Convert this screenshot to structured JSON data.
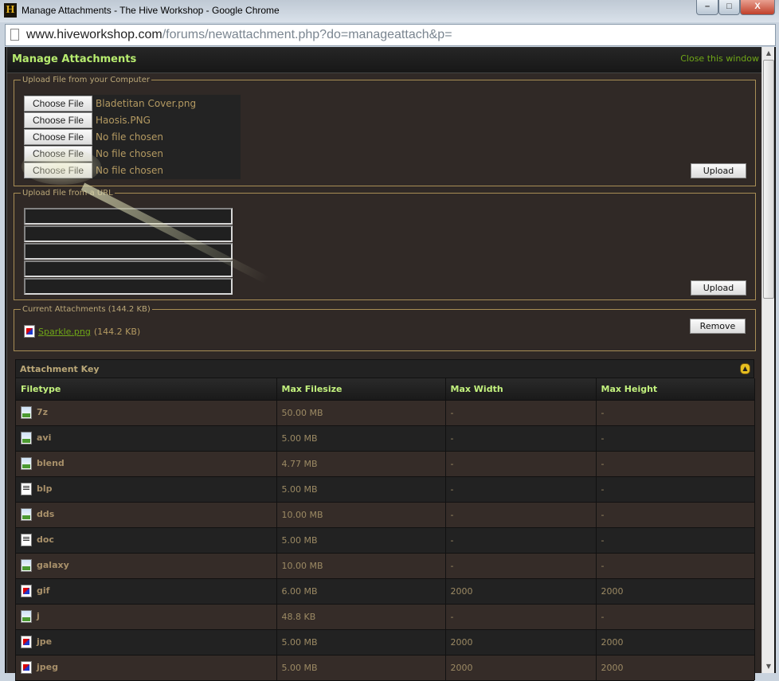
{
  "window": {
    "title": "Manage Attachments - The Hive Workshop - Google Chrome",
    "logo": "H",
    "min": "–",
    "max": "□",
    "close": "X"
  },
  "address": {
    "host": "www.hiveworkshop.com",
    "path": "/forums/newattachment.php?do=manageattach&p="
  },
  "header": {
    "title": "Manage Attachments",
    "close_link": "Close this window"
  },
  "upload_computer": {
    "legend": "Upload File from your Computer",
    "choose_label": "Choose File",
    "files": [
      "Bladetitan Cover.png",
      "Haosis.PNG",
      "No file chosen",
      "No file chosen",
      "No file chosen"
    ],
    "upload_label": "Upload"
  },
  "upload_url": {
    "legend": "Upload File from a URL",
    "inputs": [
      "",
      "",
      "",
      "",
      ""
    ],
    "upload_label": "Upload"
  },
  "current": {
    "legend": "Current Attachments (144.2 KB)",
    "file": "Sparkle.png",
    "size": "(144.2 KB)",
    "remove_label": "Remove"
  },
  "key": {
    "title": "Attachment Key",
    "columns": [
      "Filetype",
      "Max Filesize",
      "Max Width",
      "Max Height"
    ],
    "rows": [
      {
        "type": "7z",
        "size": "50.00 MB",
        "w": "-",
        "h": "-",
        "icon": "img"
      },
      {
        "type": "avi",
        "size": "5.00 MB",
        "w": "-",
        "h": "-",
        "icon": "img"
      },
      {
        "type": "blend",
        "size": "4.77 MB",
        "w": "-",
        "h": "-",
        "icon": "img"
      },
      {
        "type": "blp",
        "size": "5.00 MB",
        "w": "-",
        "h": "-",
        "icon": "txt"
      },
      {
        "type": "dds",
        "size": "10.00 MB",
        "w": "-",
        "h": "-",
        "icon": "img"
      },
      {
        "type": "doc",
        "size": "5.00 MB",
        "w": "-",
        "h": "-",
        "icon": "txt"
      },
      {
        "type": "galaxy",
        "size": "10.00 MB",
        "w": "-",
        "h": "-",
        "icon": "img"
      },
      {
        "type": "gif",
        "size": "6.00 MB",
        "w": "2000",
        "h": "2000",
        "icon": "pic"
      },
      {
        "type": "j",
        "size": "48.8 KB",
        "w": "-",
        "h": "-",
        "icon": "img"
      },
      {
        "type": "jpe",
        "size": "5.00 MB",
        "w": "2000",
        "h": "2000",
        "icon": "pic"
      },
      {
        "type": "jpeg",
        "size": "5.00 MB",
        "w": "2000",
        "h": "2000",
        "icon": "pic"
      }
    ]
  },
  "colors": {
    "accent": "#b7ec6f",
    "link": "#6fa617",
    "text": "#b49a62",
    "bg": "#302926"
  }
}
